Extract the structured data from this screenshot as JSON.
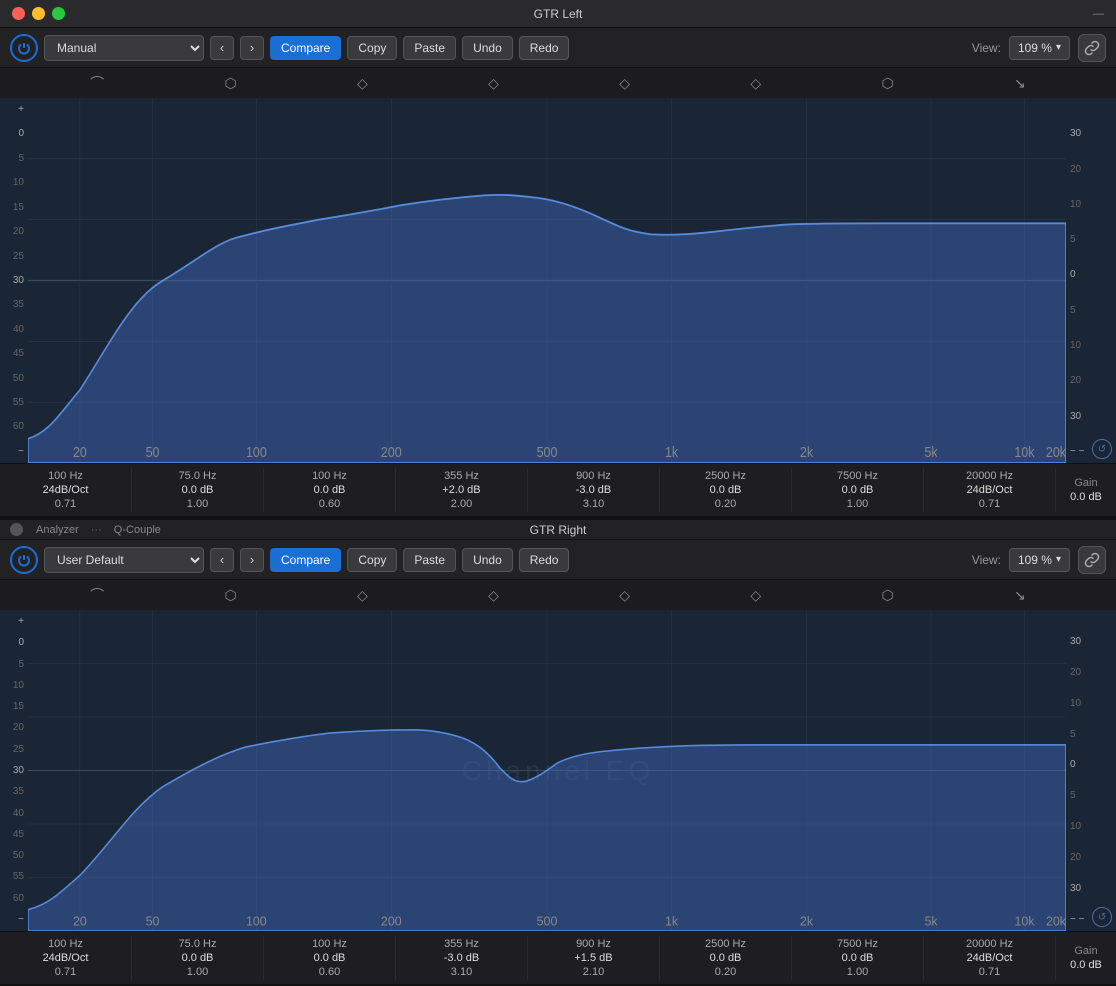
{
  "app": {
    "top_title": "GTR Left",
    "top_link": "—"
  },
  "panels": [
    {
      "id": "gtr-left",
      "title": "GTR Left",
      "preset": "Manual",
      "buttons": {
        "compare": "Compare",
        "copy": "Copy",
        "paste": "Paste",
        "undo": "Undo",
        "redo": "Redo"
      },
      "view_label": "View:",
      "view_value": "109 %",
      "analyzer_label": "Analyzer",
      "q_couple_label": "Q-Couple",
      "db_ticks_left": [
        "+",
        "0",
        "5",
        "10",
        "15",
        "20",
        "25",
        "30",
        "35",
        "40",
        "45",
        "50",
        "55",
        "60",
        "-"
      ],
      "db_ticks_right": [
        "30",
        "20",
        "10",
        "5",
        "0",
        "5",
        "10",
        "20",
        "30"
      ],
      "freq_ticks": [
        "20",
        "50",
        "100",
        "200",
        "500",
        "1k",
        "2k",
        "5k",
        "10k",
        "20k"
      ],
      "bands": [
        {
          "freq": "100 Hz",
          "type": "24dB/Oct",
          "gain": "",
          "q": "0.71"
        },
        {
          "freq": "75.0 Hz",
          "type": "",
          "gain": "0.0 dB",
          "q": "1.00"
        },
        {
          "freq": "100 Hz",
          "type": "",
          "gain": "0.0 dB",
          "q": "0.60"
        },
        {
          "freq": "355 Hz",
          "type": "",
          "gain": "+2.0 dB",
          "q": "2.00"
        },
        {
          "freq": "900 Hz",
          "type": "",
          "gain": "-3.0 dB",
          "q": "3.10"
        },
        {
          "freq": "2500 Hz",
          "type": "",
          "gain": "0.0 dB",
          "q": "0.20"
        },
        {
          "freq": "7500 Hz",
          "type": "",
          "gain": "0.0 dB",
          "q": "1.00"
        },
        {
          "freq": "20000 Hz",
          "type": "24dB/Oct",
          "gain": "",
          "q": "0.71"
        },
        {
          "freq": "Gain",
          "type": "",
          "gain": "0.0 dB",
          "q": ""
        }
      ],
      "curve_color": "rgba(70,120,200,0.6)"
    },
    {
      "id": "gtr-right",
      "title": "GTR Right",
      "preset": "User Default",
      "buttons": {
        "compare": "Compare",
        "copy": "Copy",
        "paste": "Paste",
        "undo": "Undo",
        "redo": "Redo"
      },
      "view_label": "View:",
      "view_value": "109 %",
      "analyzer_label": "Analyzer",
      "q_couple_label": "Q-Couple",
      "channel_eq_label": "Channel EQ",
      "db_ticks_left": [
        "+",
        "0",
        "5",
        "10",
        "15",
        "20",
        "25",
        "30",
        "35",
        "40",
        "45",
        "50",
        "55",
        "60",
        "-"
      ],
      "db_ticks_right": [
        "30",
        "20",
        "10",
        "5",
        "0",
        "5",
        "10",
        "20",
        "30"
      ],
      "freq_ticks": [
        "20",
        "50",
        "100",
        "200",
        "500",
        "1k",
        "2k",
        "5k",
        "10k",
        "20k"
      ],
      "bands": [
        {
          "freq": "100 Hz",
          "type": "24dB/Oct",
          "gain": "",
          "q": "0.71"
        },
        {
          "freq": "75.0 Hz",
          "type": "",
          "gain": "0.0 dB",
          "q": "1.00"
        },
        {
          "freq": "100 Hz",
          "type": "",
          "gain": "0.0 dB",
          "q": "0.60"
        },
        {
          "freq": "355 Hz",
          "type": "",
          "gain": "-3.0 dB",
          "q": "3.10"
        },
        {
          "freq": "900 Hz",
          "type": "",
          "gain": "+1.5 dB",
          "q": "2.10"
        },
        {
          "freq": "2500 Hz",
          "type": "",
          "gain": "0.0 dB",
          "q": "0.20"
        },
        {
          "freq": "7500 Hz",
          "type": "",
          "gain": "0.0 dB",
          "q": "1.00"
        },
        {
          "freq": "20000 Hz",
          "type": "24dB/Oct",
          "gain": "",
          "q": "0.71"
        },
        {
          "freq": "Gain",
          "type": "",
          "gain": "0.0 dB",
          "q": ""
        }
      ],
      "curve_color": "rgba(70,120,200,0.6)"
    }
  ],
  "icons": {
    "power": "⏻",
    "left_arrow": "‹",
    "right_arrow": "›",
    "chevron_down": "▾",
    "link": "🔗",
    "reset": "↺",
    "plus": "+",
    "minus": "−"
  }
}
